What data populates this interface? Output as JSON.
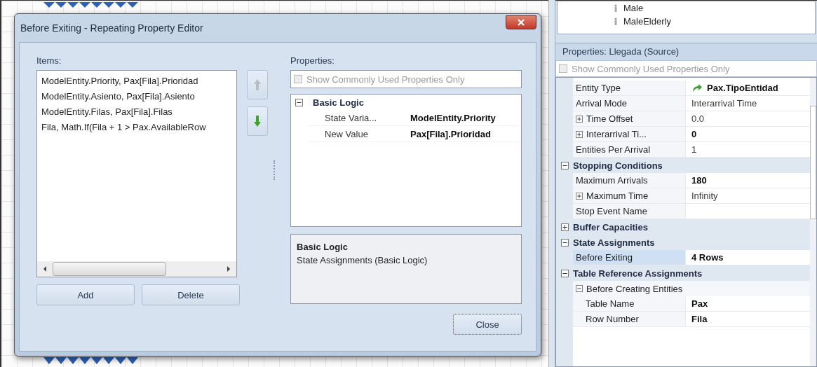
{
  "dialog": {
    "title": "Before Exiting - Repeating Property Editor",
    "items_label": "Items:",
    "items": [
      "ModelEntity.Priority, Pax[Fila].Prioridad",
      "ModelEntity.Asiento, Pax[Fila].Asiento",
      "ModelEntity.Filas, Pax[Fila].Filas",
      "Fila, Math.If(Fila + 1 > Pax.AvailableRow"
    ],
    "move_up": {
      "disabled": true
    },
    "move_down": {
      "disabled": false
    },
    "buttons": [
      "Add",
      "Delete"
    ],
    "properties_label": "Properties:",
    "common_only": {
      "label": "Show Commonly Used Properties Only",
      "checked": false
    },
    "grid": [
      {
        "kind": "category",
        "label": "Basic Logic",
        "expanded": true,
        "children": [
          {
            "kind": "property",
            "name": "State Varia...",
            "value": "ModelEntity.Priority",
            "bold": true
          },
          {
            "kind": "property",
            "name": "New Value",
            "value": "Pax[Fila].Prioridad",
            "bold": true
          }
        ]
      }
    ],
    "description": {
      "title": "Basic Logic",
      "text": "State Assignments (Basic Logic)"
    },
    "close": "Close"
  },
  "panel": {
    "list": [
      "Male",
      "MaleElderly"
    ],
    "title": "Properties: Llegada (Source)",
    "common_only": {
      "label": "Show Commonly Used Properties Only",
      "checked": false
    },
    "grid": [
      {
        "kind": "reference",
        "name": "Entity Type",
        "value": "Pax.TipoEntidad",
        "bold": true,
        "selected": false
      },
      {
        "kind": "property",
        "name": "Arrival Mode",
        "value": "Interarrival Time",
        "bold": false,
        "selected": false
      },
      {
        "kind": "property",
        "name": "Time Offset",
        "value": "0.0",
        "bold": false,
        "selected": false,
        "expanded": false
      },
      {
        "kind": "property",
        "name": "Interarrival Ti...",
        "value": "0",
        "bold": true,
        "selected": false,
        "expanded": false
      },
      {
        "kind": "property",
        "name": "Entities Per Arrival",
        "value": "1",
        "bold": false,
        "selected": false
      },
      {
        "kind": "category",
        "label": "Stopping Conditions",
        "expanded": true,
        "children": [
          {
            "kind": "property",
            "name": "Maximum Arrivals",
            "value": "180",
            "bold": true,
            "selected": false
          },
          {
            "kind": "property",
            "name": "Maximum Time",
            "value": "Infinity",
            "bold": false,
            "selected": false,
            "expanded": false
          },
          {
            "kind": "property",
            "name": "Stop Event Name",
            "selected": false
          }
        ]
      },
      {
        "kind": "category",
        "label": "Buffer Capacities",
        "expanded": false
      },
      {
        "kind": "category",
        "label": "State Assignments",
        "expanded": true,
        "children": [
          {
            "kind": "property",
            "name": "Before Exiting",
            "value": "4 Rows",
            "bold": true,
            "selected": true
          }
        ]
      },
      {
        "kind": "category",
        "label": "Table Reference Assignments",
        "expanded": true,
        "children": [
          {
            "kind": "group",
            "label": "Before Creating Entities",
            "expanded": true,
            "children": [
              {
                "kind": "property",
                "name": "Table Name",
                "value": "Pax",
                "bold": true,
                "selected": false
              },
              {
                "kind": "property",
                "name": "Row Number",
                "value": "Fila",
                "bold": true,
                "selected": false
              }
            ]
          }
        ]
      }
    ]
  }
}
